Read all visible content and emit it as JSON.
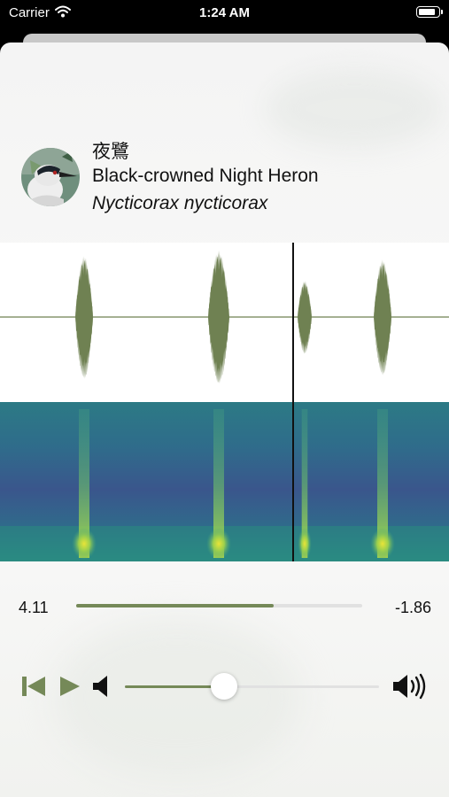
{
  "status_bar": {
    "carrier": "Carrier",
    "time": "1:24 AM",
    "battery_level": 0.8
  },
  "species": {
    "chinese_name": "夜鷺",
    "common_name": "Black-crowned Night Heron",
    "scientific_name": "Nycticorax nycticorax"
  },
  "player": {
    "elapsed": "4.11",
    "remaining": "-1.86",
    "progress": 0.69,
    "volume": 0.39
  },
  "colors": {
    "accent": "#758958",
    "waveform": "#6f8152",
    "spectrogram_bg": "#2f6f8a"
  },
  "icons": {
    "skip_back": "skip-back-icon",
    "play": "play-icon",
    "volume_low": "volume-low-icon",
    "volume_high": "volume-high-icon"
  }
}
